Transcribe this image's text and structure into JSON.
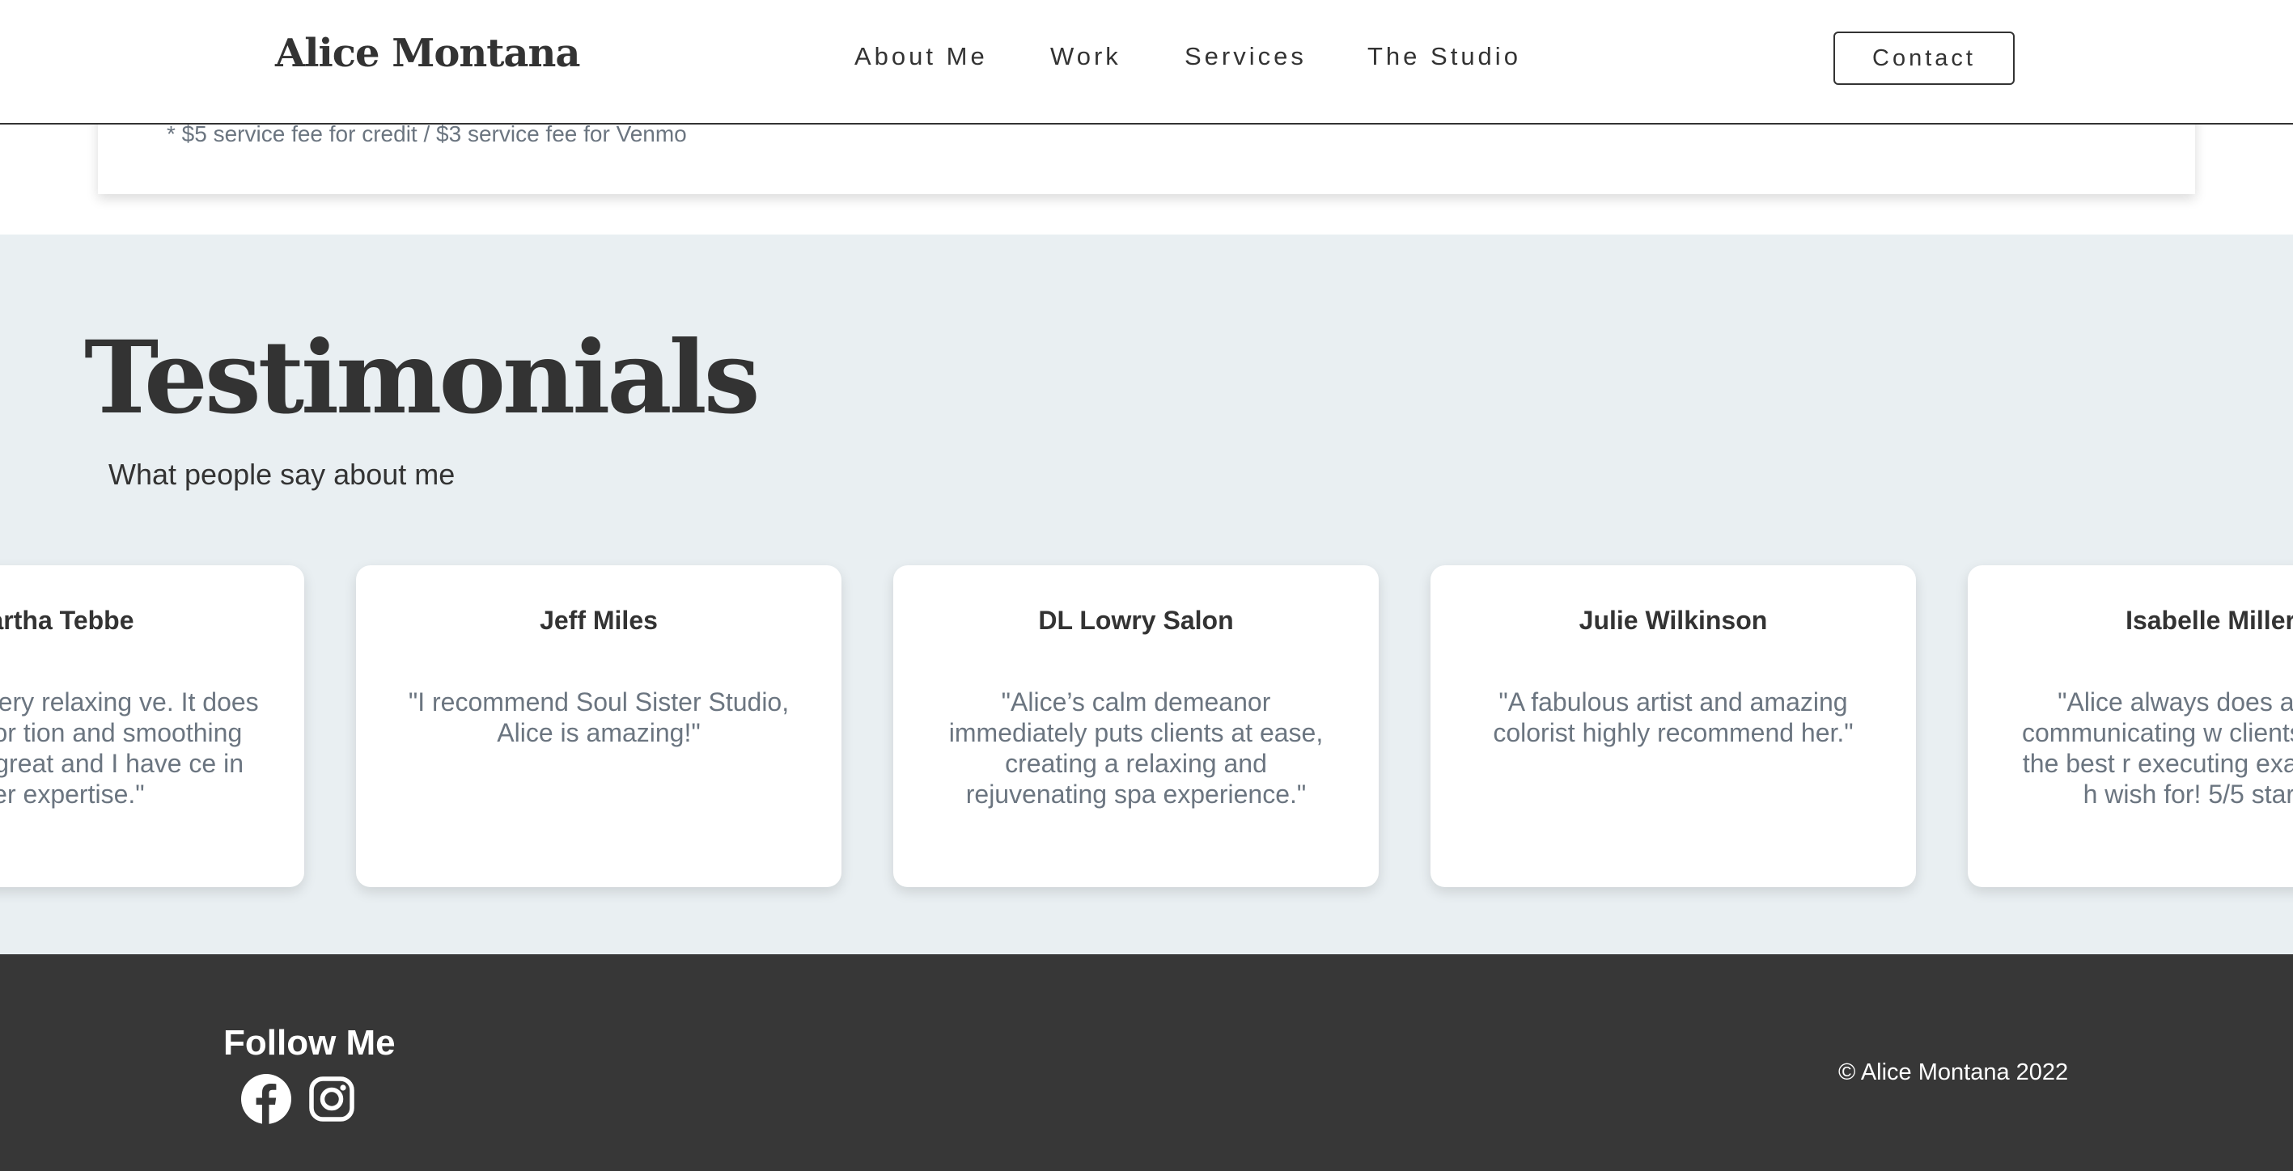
{
  "header": {
    "logo": "Alice Montana",
    "nav": [
      "About Me",
      "Work",
      "Services",
      "The Studio"
    ],
    "contact_label": "Contact"
  },
  "pricing": {
    "fee_note": "* $5 service fee for credit / $3 service fee for Venmo"
  },
  "testimonials": {
    "title": "Testimonials",
    "subtitle": "What people say about me",
    "cards": [
      {
        "name": "artha Tebbe",
        "quote": "facial was very relaxing ve. It does wonders for tion and smoothing out lice is great and I have ce in her expertise.\""
      },
      {
        "name": "Jeff Miles",
        "quote": "\"I recommend Soul Sister Studio, Alice is amazing!\""
      },
      {
        "name": "DL Lowry Salon",
        "quote": "\"Alice’s calm demeanor immediately puts clients at ease, creating a relaxing and rejuvenating spa experience.\""
      },
      {
        "name": "Julie Wilkinson",
        "quote": "\"A fabulous artist and amazing colorist highly recommend her.\""
      },
      {
        "name": "Isabelle Miller",
        "quote": "\"Alice always does an i job communicating w clients, playing the best r executing exactly what h wish for! 5/5 star ser"
      }
    ]
  },
  "footer": {
    "follow_title": "Follow Me",
    "icons": [
      "facebook-icon",
      "instagram-icon"
    ],
    "copyright": "© Alice Montana 2022"
  },
  "colors": {
    "text_dark": "#333333",
    "text_muted": "#6b7580",
    "section_bg": "#e9eff2",
    "footer_bg": "#373737"
  }
}
